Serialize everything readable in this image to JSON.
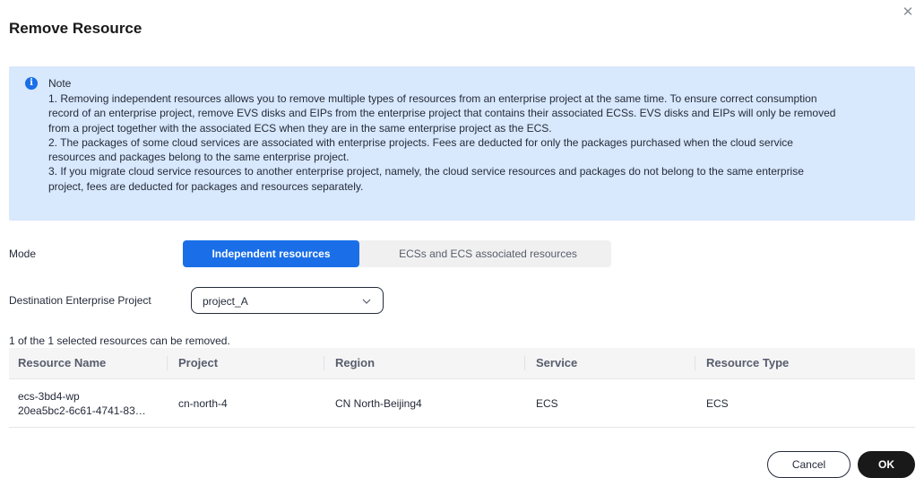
{
  "dialog": {
    "title": "Remove Resource",
    "close_icon": "close-icon"
  },
  "note": {
    "icon": "info-icon",
    "icon_glyph": "i",
    "title": "Note",
    "lines": [
      "1. Removing independent resources allows you to remove multiple types of resources from an enterprise project at the same time. To ensure correct consumption",
      "record of an enterprise project, remove EVS disks and EIPs from the enterprise project that contains their associated ECSs. EVS disks and EIPs will only be removed",
      "from a project together with the associated ECS when they are in the same enterprise project as the ECS.",
      "2. The packages of some cloud services are associated with enterprise projects. Fees are deducted for only the packages purchased when the cloud service",
      "resources and packages belong to the same enterprise project.",
      "3. If you migrate cloud service resources to another enterprise project, namely, the cloud service resources and packages do not belong to the same enterprise",
      "project, fees are deducted for packages and resources separately."
    ]
  },
  "mode": {
    "label": "Mode",
    "options": [
      "Independent resources",
      "ECSs and ECS associated resources"
    ],
    "selected": "Independent resources"
  },
  "destination": {
    "label": "Destination Enterprise Project",
    "value": "project_A",
    "arrow_icon": "chevron-down-icon"
  },
  "summary": "1 of the 1 selected resources can be removed.",
  "table": {
    "columns": [
      "Resource Name",
      "Project",
      "Region",
      "Service",
      "Resource Type"
    ],
    "rows": [
      {
        "name_line1": "ecs-3bd4-wp",
        "name_line2": "20ea5bc2-6c61-4741-83…",
        "project": "cn-north-4",
        "region": "CN North-Beijing4",
        "service": "ECS",
        "resource_type": "ECS"
      }
    ]
  },
  "footer": {
    "cancel_label": "Cancel",
    "ok_label": "OK"
  },
  "colors": {
    "accent": "#1a6fe8",
    "note_bg": "#d8e8fd",
    "ok_bg": "#191919"
  }
}
